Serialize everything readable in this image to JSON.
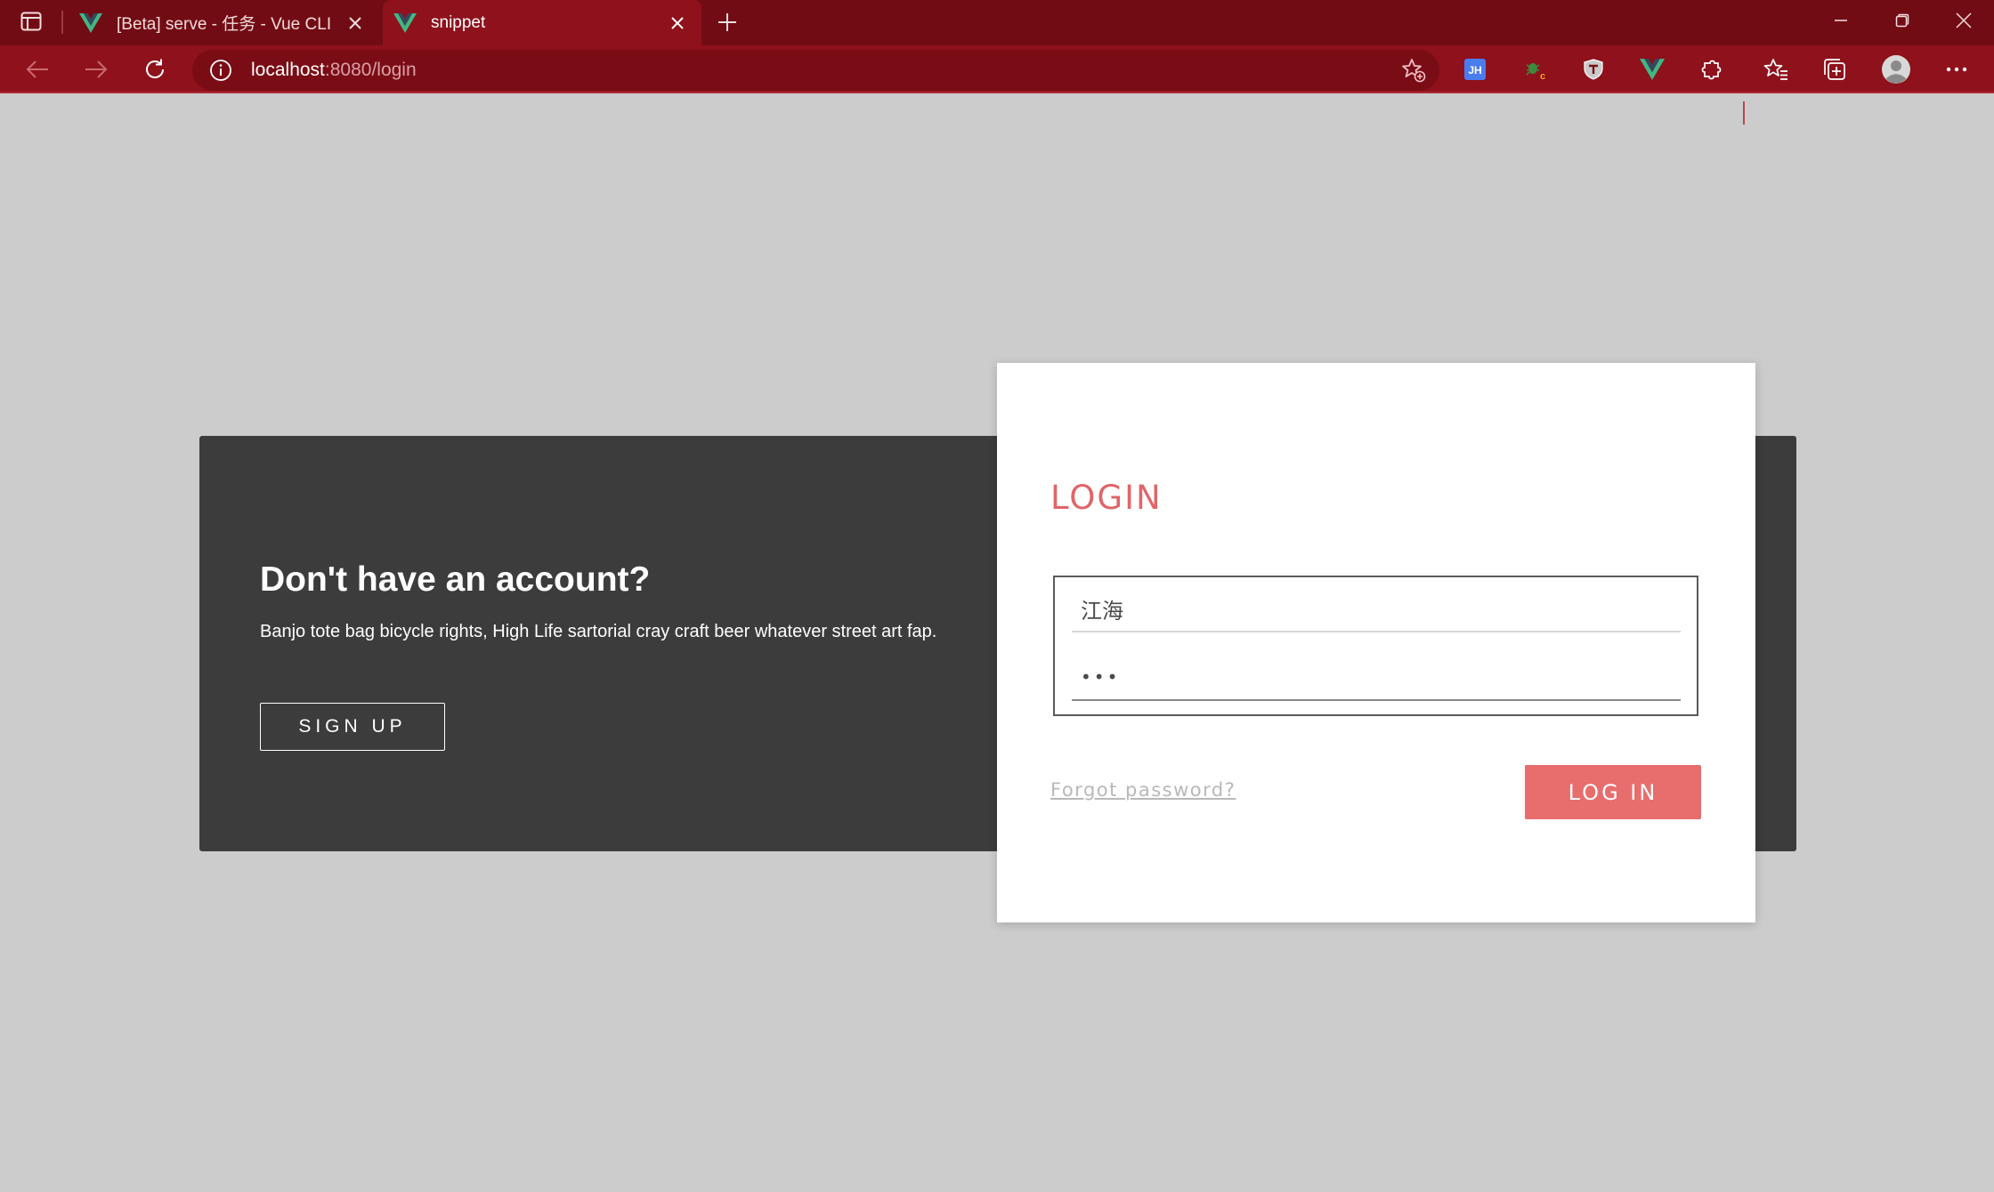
{
  "browser": {
    "tabs": [
      {
        "title": "[Beta] serve - 任务 - Vue CLI",
        "icon": "vue-icon",
        "active": false
      },
      {
        "title": "snippet",
        "icon": "vue-icon",
        "active": true
      }
    ],
    "address": {
      "host": "localhost",
      "rest": ":8080/login"
    },
    "extensions": [
      "jh-extension-icon",
      "bug-extension-icon",
      "shield-extension-icon",
      "vue-devtools-icon",
      "puzzle-icon",
      "favorites-icon",
      "collections-icon",
      "profile-avatar",
      "more-icon"
    ],
    "colors": {
      "tabbar": "#720c14",
      "toolbar": "#8e111c",
      "omnibox": "#7a0c15"
    }
  },
  "signup_panel": {
    "heading": "Don't have an account?",
    "blurb": "Banjo tote bag bicycle rights, High Life sartorial cray craft beer whatever street art fap.",
    "button_label": "SIGN UP"
  },
  "login_card": {
    "title": "LOGIN",
    "username_value": "江海",
    "password_value": "•••",
    "forgot_label": "Forgot password?",
    "login_button_label": "LOG IN",
    "accent_color": "#e86d6d"
  }
}
